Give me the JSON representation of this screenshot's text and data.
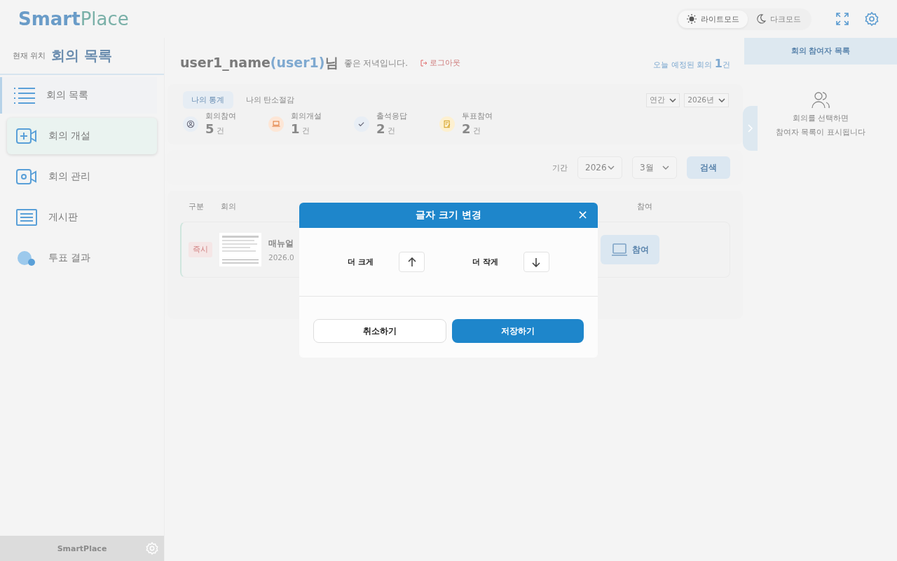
{
  "header": {
    "logo_bold": "Smart",
    "logo_light": "Place",
    "modes": [
      {
        "label": "라이트모드",
        "kind": "light",
        "selected": true
      },
      {
        "label": "다크모드",
        "kind": "dark",
        "selected": false
      }
    ]
  },
  "location": {
    "label": "현재 위치",
    "title": "회의 목록"
  },
  "sidebar": {
    "items": [
      {
        "label": "회의 목록",
        "kind": "list",
        "selected": true,
        "hovered": false
      },
      {
        "label": "회의 개설",
        "kind": "video-add",
        "selected": false,
        "hovered": true
      },
      {
        "label": "회의 관리",
        "kind": "video-gear",
        "selected": false,
        "hovered": false
      },
      {
        "label": "게시판",
        "kind": "board",
        "selected": false,
        "hovered": false
      },
      {
        "label": "투표 결과",
        "kind": "vote",
        "selected": false,
        "hovered": false
      }
    ],
    "footer": "SmartPlace"
  },
  "greeting": {
    "name": "user1_name",
    "id": "(user1)",
    "suffix": "님",
    "message": "좋은 저녁입니다.",
    "logout": "로그아웃",
    "today_label": "오늘 예정된 회의",
    "today_count": "1",
    "today_unit": "건"
  },
  "stats": {
    "tabs": [
      {
        "label": "나의 통계",
        "selected": true
      },
      {
        "label": "나의 탄소절감",
        "selected": false
      }
    ],
    "selects": [
      "연간",
      "2026년"
    ],
    "items": [
      {
        "kind": "person",
        "label": "회의참여",
        "value": "5",
        "unit": "건"
      },
      {
        "kind": "laptop",
        "label": "회의개설",
        "value": "1",
        "unit": "건"
      },
      {
        "kind": "check",
        "label": "출석응답",
        "value": "2",
        "unit": "건"
      },
      {
        "kind": "edit",
        "label": "투표참여",
        "value": "2",
        "unit": "건"
      }
    ]
  },
  "filter": {
    "label": "기간",
    "year": "2026",
    "month": "3월",
    "search": "검색"
  },
  "table": {
    "columns": [
      "구분",
      "회의",
      "참여"
    ],
    "rows": [
      {
        "type": "즉시",
        "title": "매뉴얼",
        "date": "2026.0",
        "join": "참여"
      }
    ]
  },
  "participants": {
    "title": "회의 참여자 목록",
    "empty_lines": [
      "회의를 선택하면",
      "참여자 목록이 표시됩니다"
    ]
  },
  "dialog": {
    "title": "글자 크기 변경",
    "close": "×",
    "options": [
      {
        "label": "더 크게",
        "kind": "up"
      },
      {
        "label": "더 작게",
        "kind": "down"
      }
    ],
    "cancel": "취소하기",
    "save": "저장하기"
  }
}
